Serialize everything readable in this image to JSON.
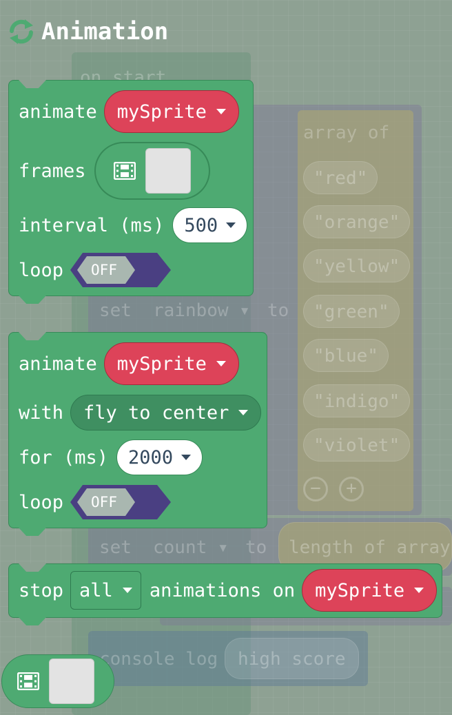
{
  "category": {
    "title": "Animation",
    "icon": "refresh-icon"
  },
  "workspace": {
    "on_start": "on start",
    "array_of": "array of",
    "colors": [
      "red",
      "orange",
      "yellow",
      "green",
      "blue",
      "indigo",
      "violet"
    ],
    "set_rainbow": {
      "set": "set",
      "var": "rainbow",
      "to": "to"
    },
    "set_count": {
      "set": "set",
      "var": "count",
      "to": "to",
      "value": "length of array"
    },
    "console_log": "console log",
    "high_score": "high score"
  },
  "blocks": {
    "animate_frames": {
      "animate": "animate",
      "sprite": "mySprite",
      "frames": "frames",
      "interval": "interval (ms)",
      "interval_value": "500",
      "loop": "loop",
      "loop_value": "OFF"
    },
    "animate_path": {
      "animate": "animate",
      "sprite": "mySprite",
      "with": "with",
      "path": "fly to center",
      "for": "for (ms)",
      "duration": "2000",
      "loop": "loop",
      "loop_value": "OFF"
    },
    "stop": {
      "stop": "stop",
      "which": "all",
      "animations_on": "animations on",
      "sprite": "mySprite"
    }
  },
  "colors": {
    "block": "#4eaa72",
    "sprite": "#dd4359",
    "toggle": "#4a3f82",
    "toggle_off": "#a9b7b0",
    "background": "#8ea193"
  }
}
